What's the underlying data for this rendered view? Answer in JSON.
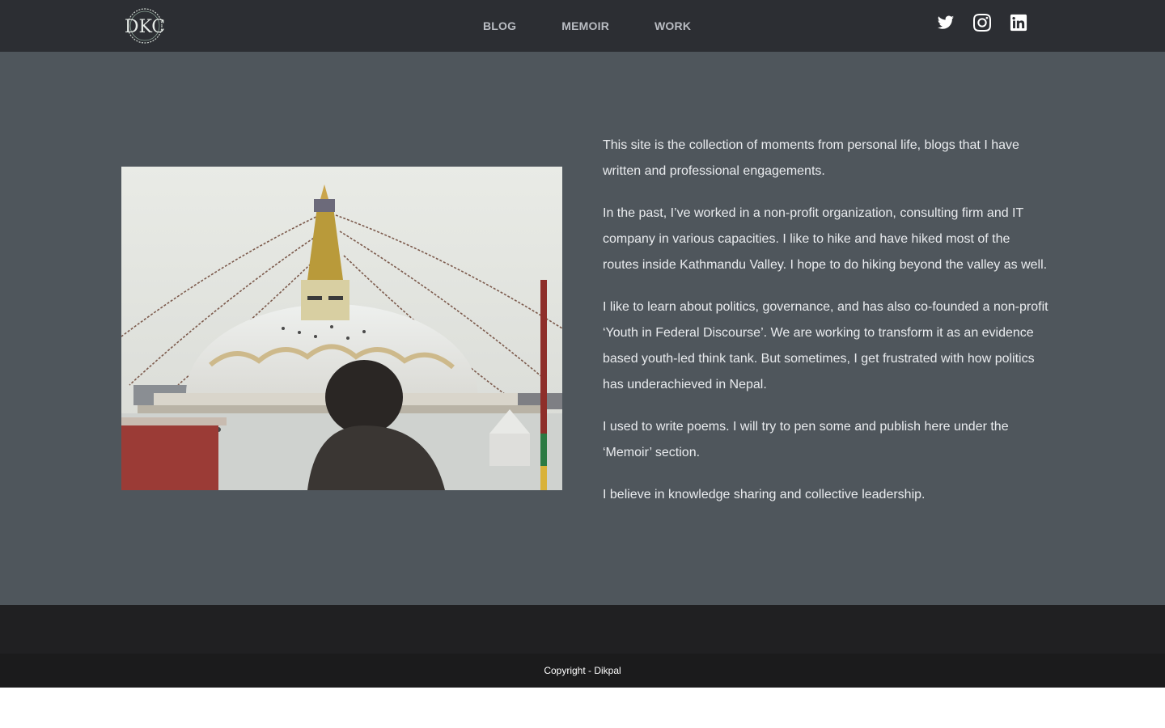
{
  "header": {
    "logo_text": "DKC",
    "nav": [
      {
        "label": "BLOG"
      },
      {
        "label": "MEMOIR"
      },
      {
        "label": "WORK"
      }
    ],
    "social": [
      {
        "name": "twitter-icon"
      },
      {
        "name": "instagram-icon"
      },
      {
        "name": "linkedin-icon"
      }
    ]
  },
  "about": {
    "image_subject": "boudhanath-stupa-photo",
    "paragraphs": [
      "This site is the collection of moments from personal life, blogs that I have written and professional engagements.",
      "In the past, I’ve worked in a non-profit organization, consulting firm and IT company in various capacities. I like to hike and have hiked most of the routes inside Kathmandu Valley. I hope to do hiking beyond the valley as well.",
      "I like to learn about politics, governance, and has also co-founded a non-profit ‘Youth in Federal Discourse’. We are working to transform it as an evidence based youth-led think tank. But sometimes, I get frustrated with how politics has underachieved in Nepal.",
      "I used to write poems. I will try to pen some and publish here under the ‘Memoir’ section.",
      "I believe in knowledge sharing and collective leadership."
    ]
  },
  "footer": {
    "copyright": "Copyright - Dikpal"
  },
  "colors": {
    "header_bg": "#2c2e33",
    "section_bg": "#4f565c",
    "footer_upper_bg": "#202022",
    "footer_lower_bg": "#1b1b1c",
    "nav_text": "#b9bcc2"
  }
}
